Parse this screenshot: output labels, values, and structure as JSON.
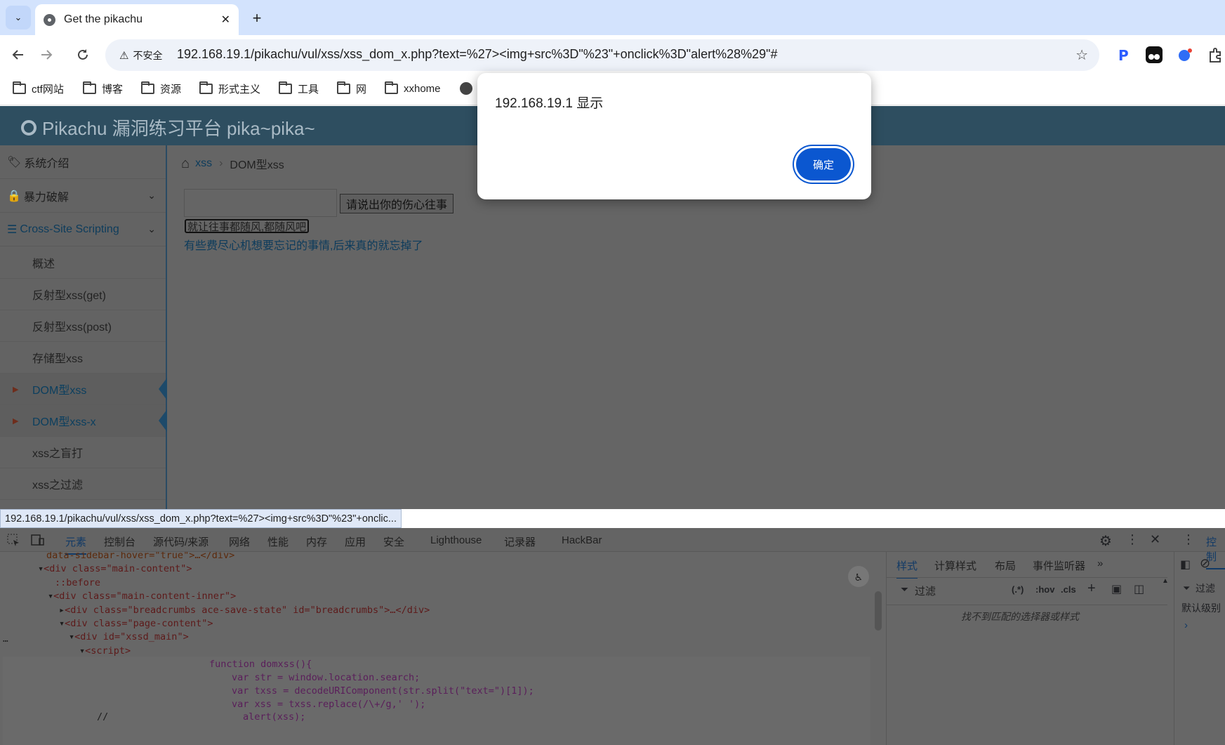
{
  "browser": {
    "tab_title": "Get the pikachu",
    "close_glyph": "✕",
    "newtab_glyph": "+",
    "tab_dropdown_glyph": "⌄",
    "security_label": "不安全",
    "url": "192.168.19.1/pikachu/vul/xss/xss_dom_x.php?text=%27><img+src%3D\"%23\"+onclick%3D\"alert%28%29\"#"
  },
  "bookmarks": [
    "ctf网站",
    "博客",
    "资源",
    "形式主义",
    "工具",
    "网",
    "xxhome"
  ],
  "site": {
    "brand": "Pikachu 漏洞练习平台 pika~pika~",
    "sidebar": {
      "top_items": [
        "系统介绍",
        "暴力破解",
        "Cross-Site Scripting"
      ],
      "sub_items": [
        "概述",
        "反射型xss(get)",
        "反射型xss(post)",
        "存储型xss",
        "DOM型xss",
        "DOM型xss-x",
        "xss之盲打",
        "xss之过滤"
      ]
    },
    "breadcrumb": {
      "link": "xss",
      "current": "DOM型xss"
    },
    "submit_label": "请说出你的伤心往事",
    "broken_image_alt": "就让往事都随风,都随风吧",
    "hint_link": "有些费尽心机想要忘记的事情,后来真的就忘掉了"
  },
  "status_url": "192.168.19.1/pikachu/vul/xss/xss_dom_x.php?text=%27><img+src%3D\"%23\"+onclic...",
  "devtools": {
    "tabs": [
      "元素",
      "控制台",
      "源代码/来源",
      "网络",
      "性能",
      "内存",
      "应用",
      "安全",
      "Lighthouse",
      "记录器",
      "HackBar"
    ],
    "styles_tabs": [
      "样式",
      "计算样式",
      "布局",
      "事件监听器"
    ],
    "filter_placeholder": "过滤",
    "hov": ":hov",
    "cls": ".cls",
    "regex": "(.*)",
    "no_match": "找不到匹配的选择器或样式",
    "console_tab": "控制",
    "console_filter": "过滤",
    "console_level": "默认级别",
    "dom_lines": [
      "data-sidebar-hover=\"true\">…</div>",
      "<div class=\"main-content\">",
      "::before",
      "<div class=\"main-content-inner\">",
      "<div class=\"breadcrumbs ace-save-state\" id=\"breadcrumbs\">…</div>",
      "<div class=\"page-content\">",
      "<div id=\"xssd_main\">",
      "<script>",
      "function domxss(){",
      "var str = window.location.search;",
      "var txss = decodeURIComponent(str.split(\"text=\")[1]);",
      "var xss = txss.replace(/\\+/g,' ');",
      "//",
      "alert(xss);"
    ]
  },
  "dialog": {
    "message": "192.168.19.1 显示",
    "ok_label": "确定"
  },
  "colors": {
    "accent": "#0b57d0",
    "tabstrip": "#d3e3fd",
    "navbar": "#2e4e60"
  }
}
